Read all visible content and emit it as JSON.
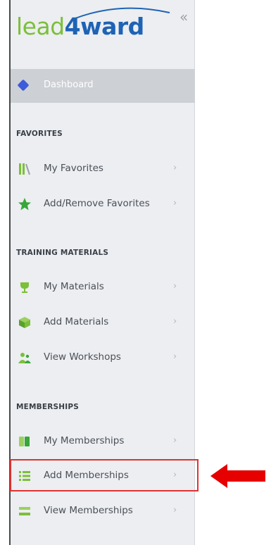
{
  "logo": {
    "part1": "lead",
    "part2": "4",
    "part3": "ward"
  },
  "collapse_icon": "«",
  "dashboard": {
    "label": "Dashboard",
    "icon": "diamond-icon"
  },
  "sections": {
    "favorites": {
      "header": "FAVORITES",
      "items": [
        {
          "label": "My Favorites",
          "icon": "books-icon"
        },
        {
          "label": "Add/Remove Favorites",
          "icon": "star-icon"
        }
      ]
    },
    "training": {
      "header": "TRAINING MATERIALS",
      "items": [
        {
          "label": "My Materials",
          "icon": "trophy-icon"
        },
        {
          "label": "Add Materials",
          "icon": "box-icon"
        },
        {
          "label": "View Workshops",
          "icon": "people-icon"
        }
      ]
    },
    "memberships": {
      "header": "MEMBERSHIPS",
      "items": [
        {
          "label": "My Memberships",
          "icon": "cards-icon"
        },
        {
          "label": "Add Memberships",
          "icon": "list-add-icon"
        },
        {
          "label": "View Memberships",
          "icon": "list-view-icon"
        }
      ]
    }
  },
  "chevron": "›",
  "colors": {
    "accent_green": "#7cbf3a",
    "brand_blue": "#1e63b5",
    "highlight_red": "#e03131"
  }
}
